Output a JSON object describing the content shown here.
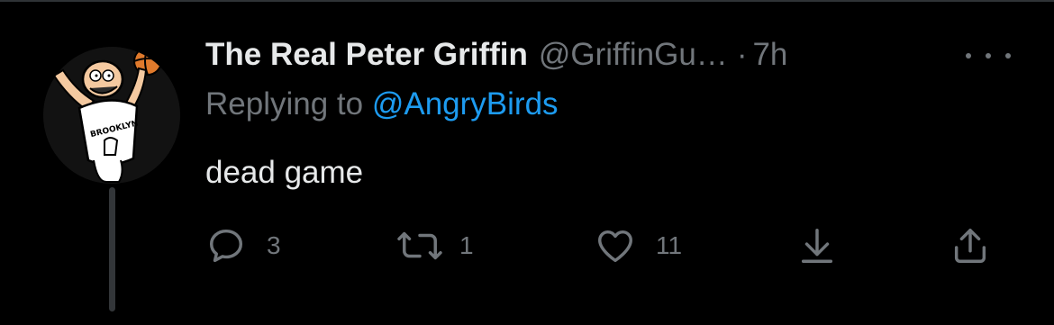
{
  "tweet": {
    "display_name": "The Real Peter Griffin",
    "handle": "@GriffinGu…",
    "separator": "·",
    "time": "7h",
    "replying_prefix": "Replying to ",
    "replying_to": "@AngryBirds",
    "text": "dead game",
    "avatar_jersey_text": "BROOKLYN"
  },
  "actions": {
    "reply": {
      "icon": "reply-bubble-icon",
      "count": "3"
    },
    "retweet": {
      "icon": "retweet-icon",
      "count": "1"
    },
    "like": {
      "icon": "heart-icon",
      "count": "11"
    },
    "save": {
      "icon": "download-arrow-icon"
    },
    "share": {
      "icon": "share-upload-icon"
    }
  },
  "colors": {
    "background": "#000000",
    "primary_text": "#e7e9ea",
    "secondary_text": "#71767b",
    "accent_link": "#1d9bf0",
    "thread_line": "#333639"
  }
}
